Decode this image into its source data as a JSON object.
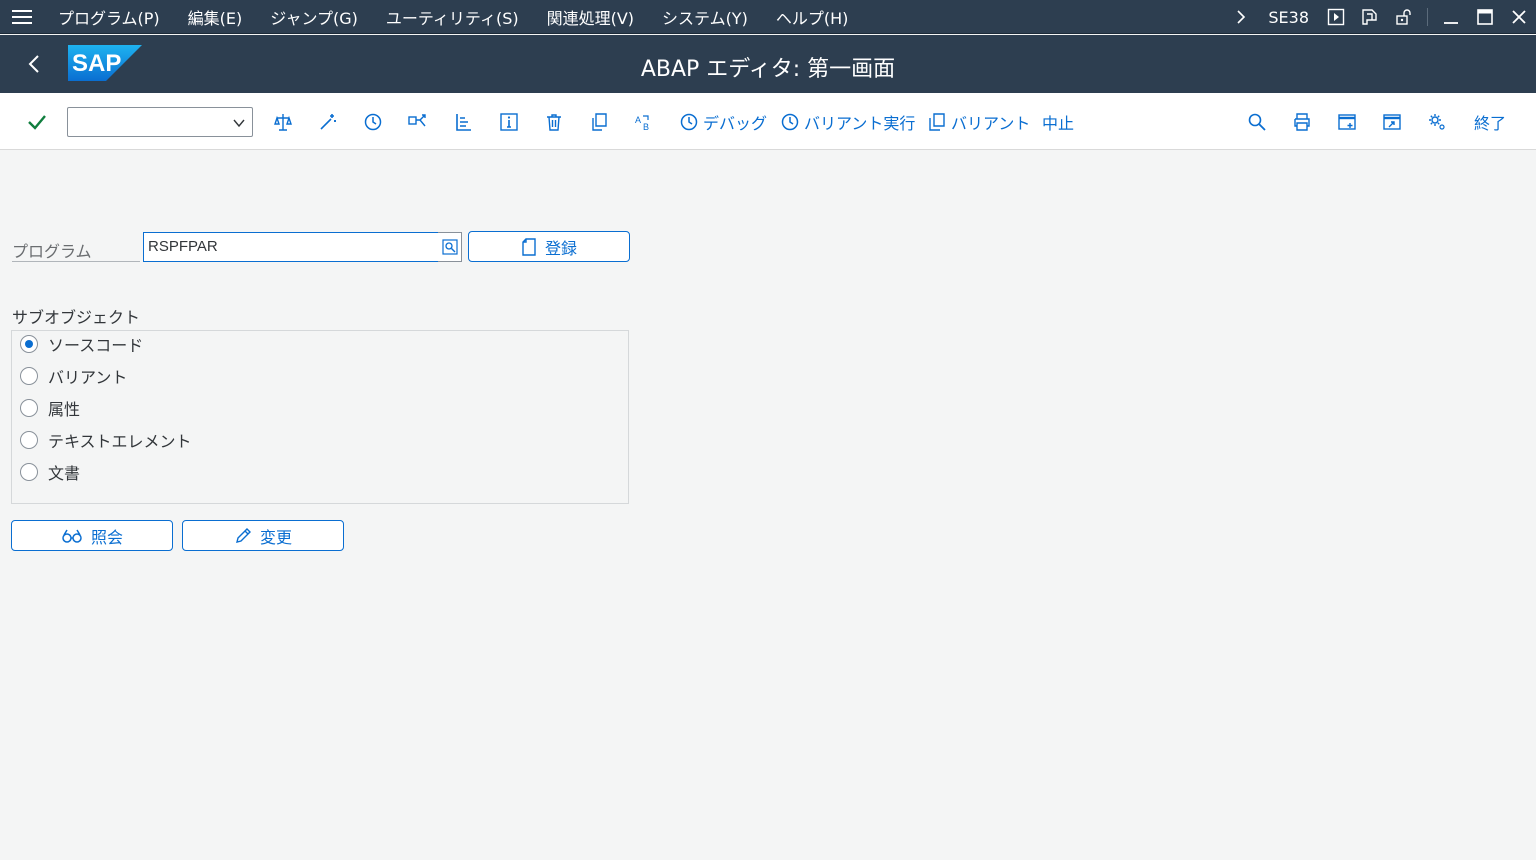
{
  "menu": {
    "items": [
      "プログラム(P)",
      "編集(E)",
      "ジャンプ(G)",
      "ユーティリティ(S)",
      "関連処理(V)",
      "システム(Y)",
      "ヘルプ(H)"
    ],
    "tcode": "SE38"
  },
  "title": "ABAP エディタ: 第一画面",
  "logo_text": "SAP",
  "toolbar": {
    "debug_label": "デバッグ",
    "variant_exec_label": "バリアント実行",
    "variant_label": "バリアント",
    "cancel_label": "中止",
    "exit_label": "終了"
  },
  "form": {
    "program_label": "プログラム",
    "program_value": "RSPFPAR",
    "create_label": "登録",
    "subobject_title": "サブオブジェクト",
    "radios": [
      {
        "label": "ソースコード",
        "selected": true
      },
      {
        "label": "バリアント",
        "selected": false
      },
      {
        "label": "属性",
        "selected": false
      },
      {
        "label": "テキストエレメント",
        "selected": false
      },
      {
        "label": "文書",
        "selected": false
      }
    ],
    "display_label": "照会",
    "change_label": "変更"
  },
  "colors": {
    "shell": "#2d3e50",
    "accent": "#0a6ed1",
    "background": "#f4f5f5"
  }
}
